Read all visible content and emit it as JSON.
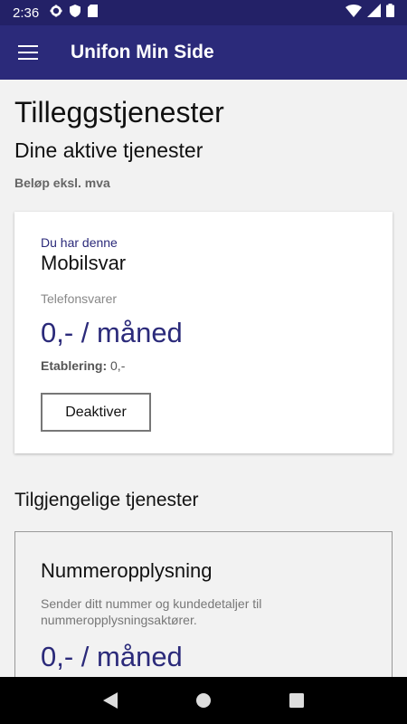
{
  "status_bar": {
    "time": "2:36",
    "icons": [
      "gear-icon",
      "shield-icon",
      "sd-card-icon",
      "wifi-icon",
      "signal-icon",
      "battery-icon"
    ]
  },
  "app_bar": {
    "title": "Unifon Min Side",
    "menu_icon": "hamburger-menu-icon"
  },
  "page": {
    "title": "Tilleggstjenester",
    "active_section_title": "Dine aktive tjenester",
    "vat_note": "Beløp eksl. mva",
    "active_service": {
      "kicker": "Du har denne",
      "name": "Mobilsvar",
      "category": "Telefonsvarer",
      "price": "0,- / måned",
      "setup_label": "Etablering:",
      "setup_value": "0,-",
      "button_label": "Deaktiver"
    },
    "available_section_title": "Tilgjengelige tjenester",
    "available_service": {
      "name": "Nummeropplysning",
      "description": "Sender ditt nummer og kundedetaljer til nummeropplysningsaktører.",
      "price": "0,- / måned"
    }
  },
  "nav_bar": {
    "icons": [
      "back-icon",
      "home-icon",
      "recents-icon"
    ]
  },
  "colors": {
    "primary": "#2b2a7a",
    "status_bar": "#232167",
    "background": "#f2f2f2"
  }
}
